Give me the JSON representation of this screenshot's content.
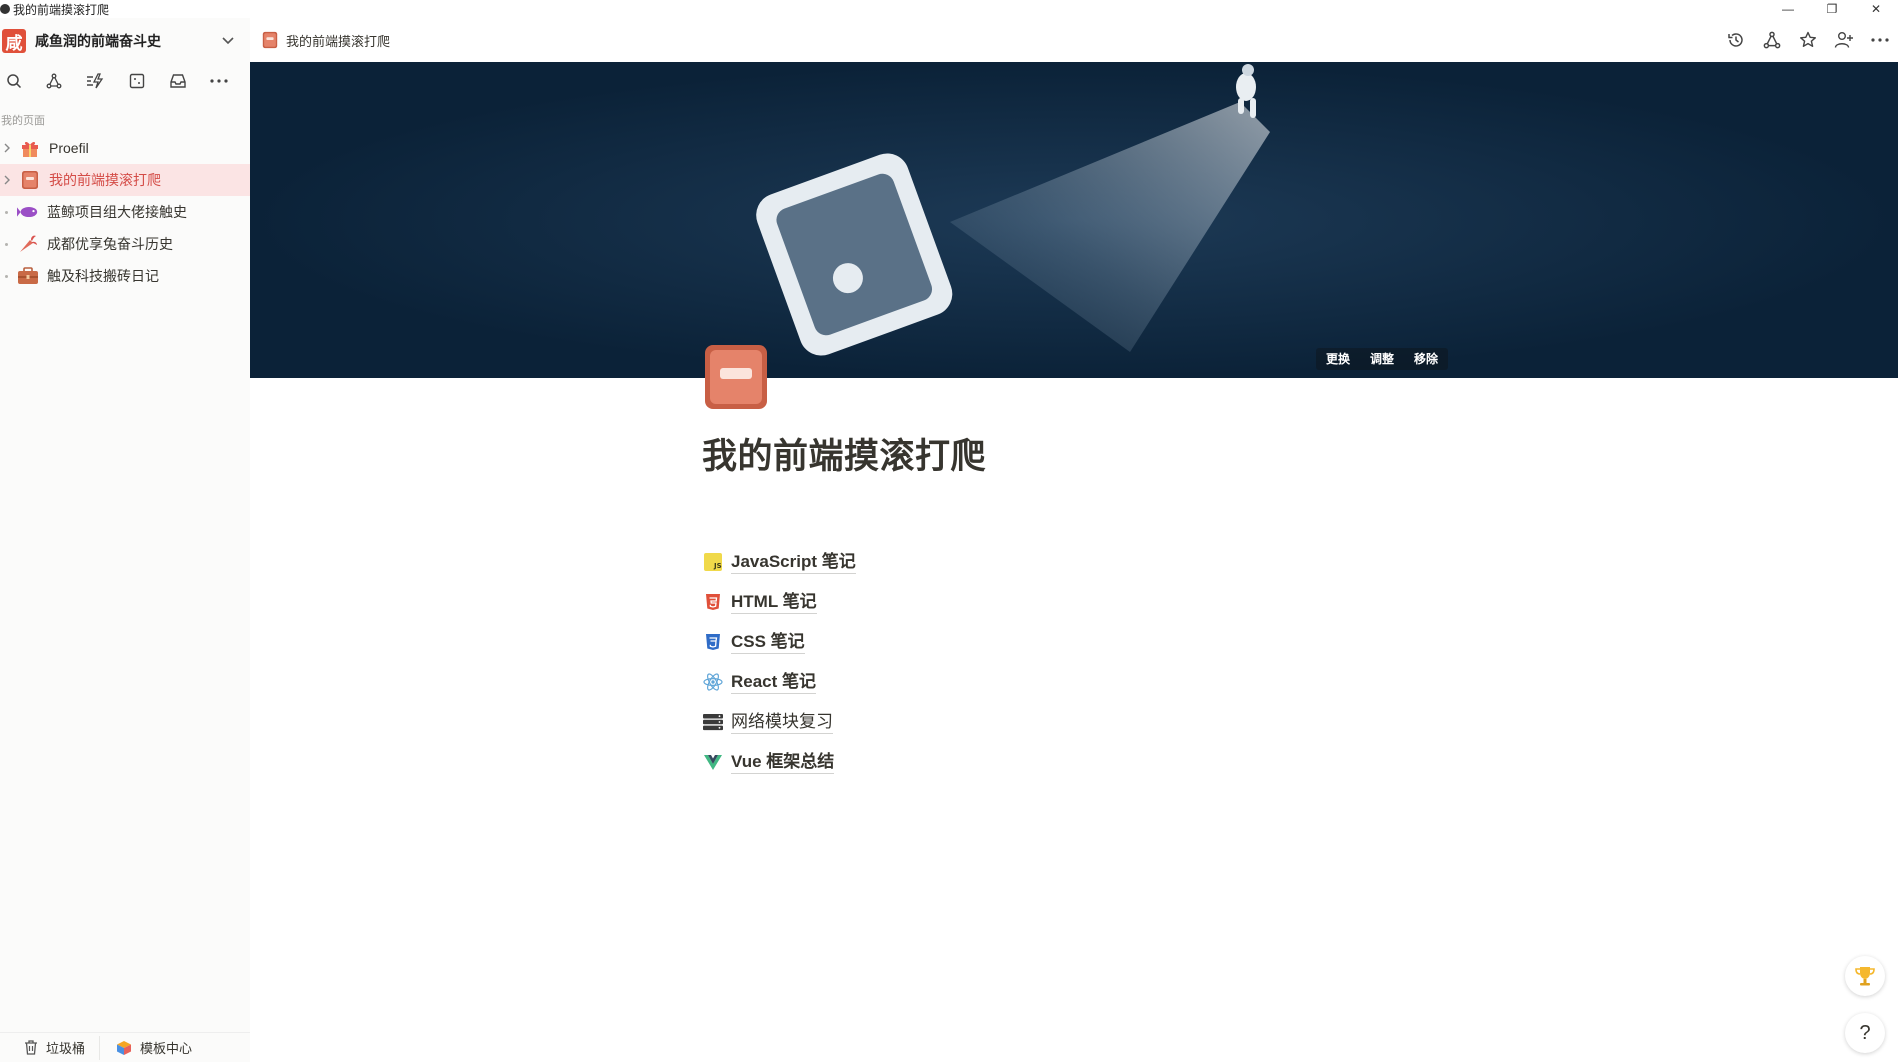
{
  "window": {
    "title": "我的前端摸滚打爬",
    "controls": [
      "—",
      "❐",
      "✕"
    ]
  },
  "sidebar": {
    "workspace_logo": "咸",
    "workspace_name": "咸鱼润的前端奋斗史",
    "tools": [
      "search-icon",
      "share-icon",
      "updates-icon",
      "templates-icon",
      "inbox-icon",
      "more-icon"
    ],
    "section_label": "我的页面",
    "pages": [
      {
        "label": "Proefil",
        "icon": "gift-icon",
        "expandable": true,
        "active": false
      },
      {
        "label": "我的前端摸滚打爬",
        "icon": "book-icon",
        "expandable": true,
        "active": true
      },
      {
        "label": "蓝鲸项目组大佬接触史",
        "icon": "fish-icon",
        "expandable": false,
        "active": false
      },
      {
        "label": "成都优享兔奋斗历史",
        "icon": "carrot-icon",
        "expandable": false,
        "active": false
      },
      {
        "label": "触及科技搬砖日记",
        "icon": "briefcase-icon",
        "expandable": false,
        "active": false
      }
    ],
    "bottom": {
      "trash_label": "垃圾桶",
      "templates_label": "模板中心"
    }
  },
  "topbar": {
    "breadcrumb_label": "我的前端摸滚打爬",
    "actions": [
      "history-icon",
      "share-icon",
      "star-icon",
      "add-user-icon",
      "more-icon"
    ]
  },
  "cover": {
    "buttons": {
      "change": "更换",
      "adjust": "调整",
      "remove": "移除"
    }
  },
  "page": {
    "title": "我的前端摸滚打爬",
    "links": [
      {
        "label": "JavaScript 笔记",
        "icon": "javascript-icon",
        "color": "#f0d94a"
      },
      {
        "label": "HTML 笔记",
        "icon": "html5-icon",
        "color": "#e0503a"
      },
      {
        "label": "CSS 笔记",
        "icon": "css3-icon",
        "color": "#2f6cc7"
      },
      {
        "label": "React 笔记",
        "icon": "react-icon",
        "color": "#61a6d8"
      },
      {
        "label": "网络模块复习",
        "icon": "server-icon",
        "color": "#3a3a3a"
      },
      {
        "label": "Vue 框架总结",
        "icon": "vue-icon",
        "color": "#41b883"
      }
    ]
  },
  "floating": {
    "help_label": "?"
  },
  "colors": {
    "active_item_bg": "#fbe4e4",
    "active_item_text": "#d44c47",
    "cover_bg": "#0b2238",
    "sidebar_bg": "#fbfbfa"
  }
}
